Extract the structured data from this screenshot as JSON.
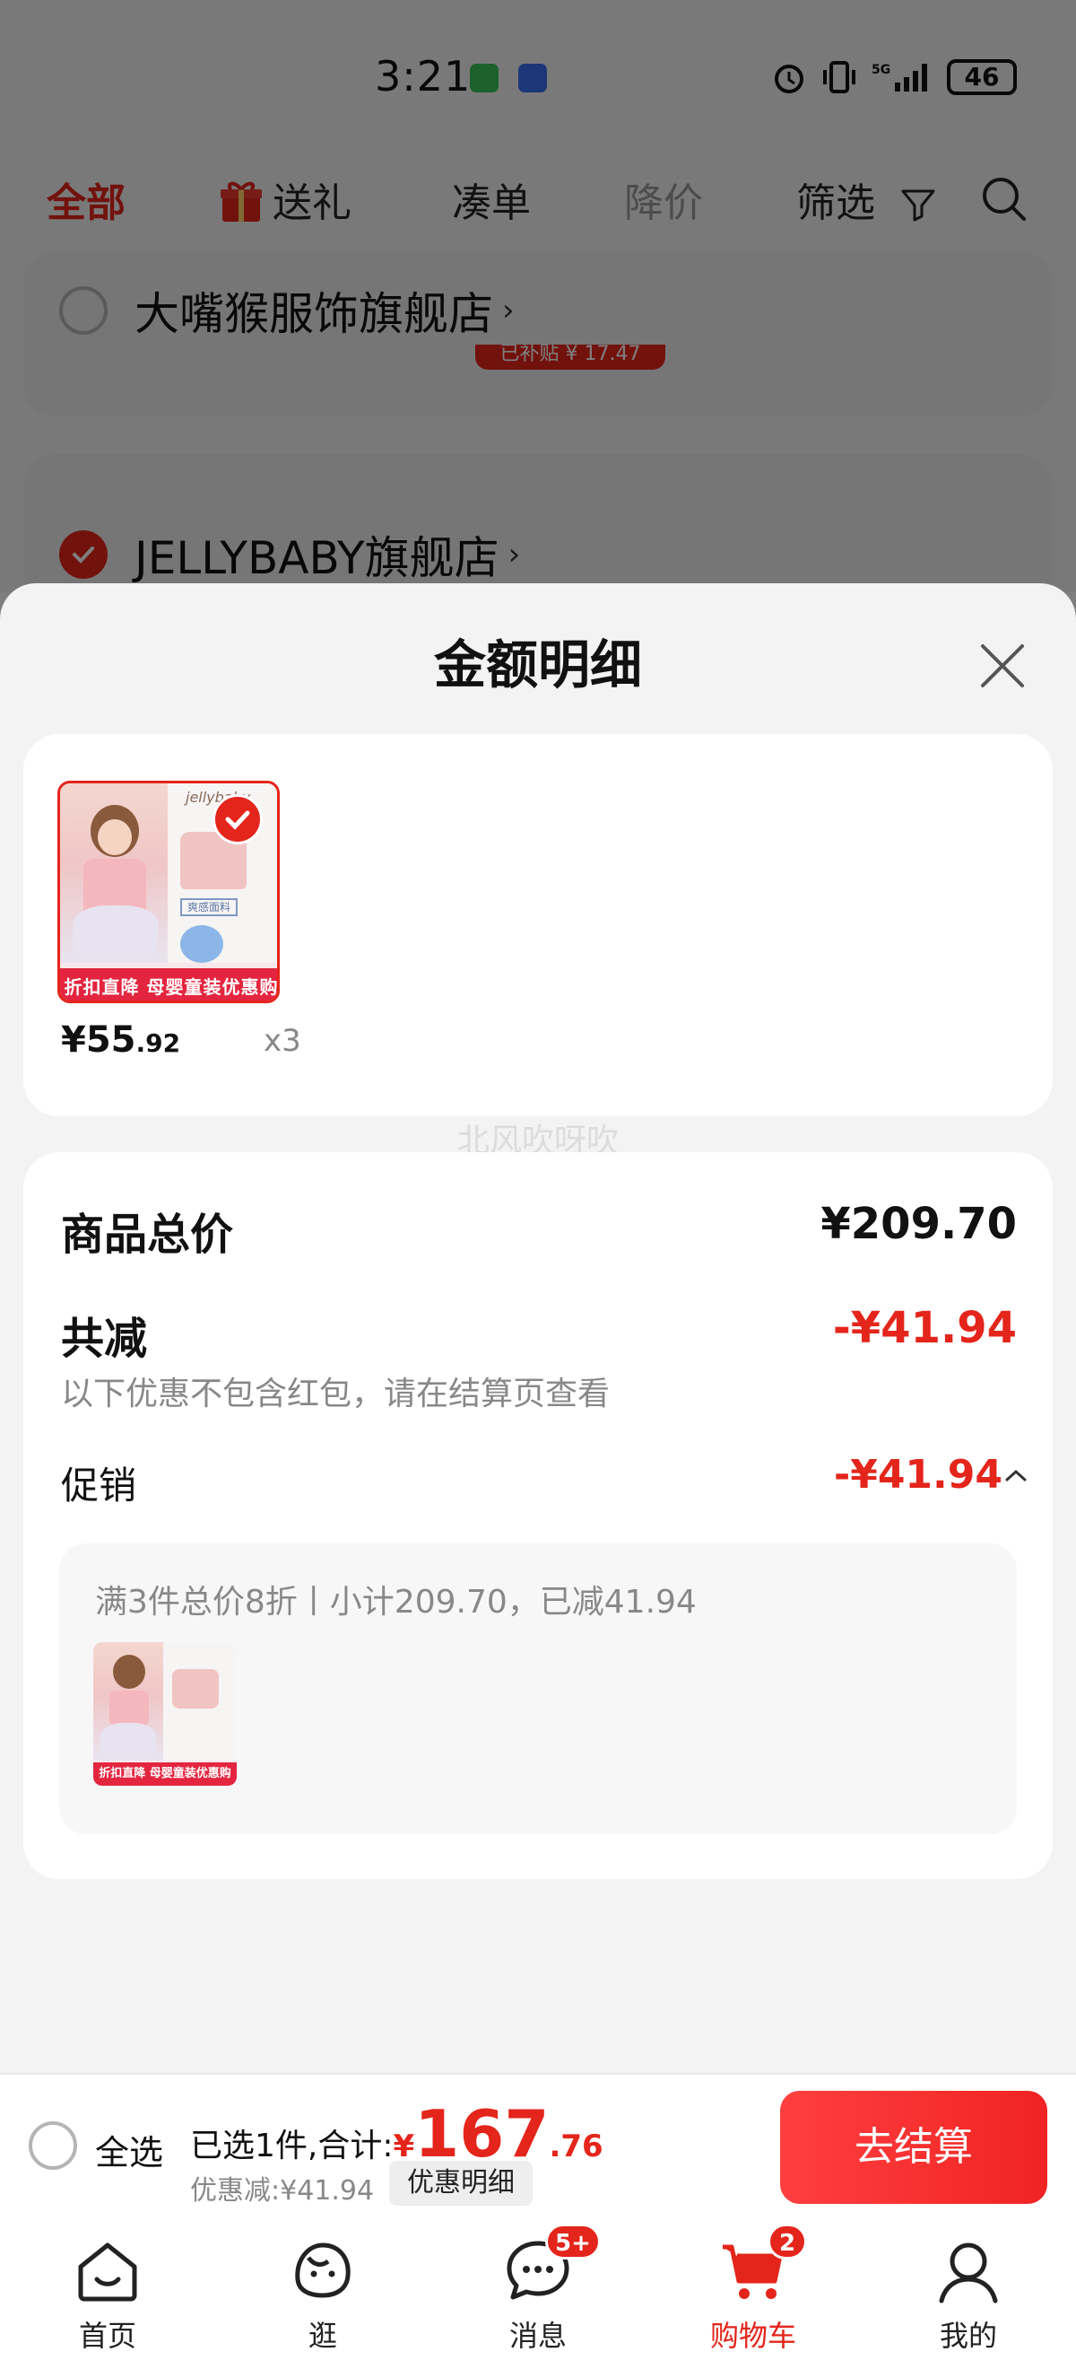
{
  "status_bar": {
    "time": "3:21",
    "battery": "46"
  },
  "top_tabs": {
    "all": "全部",
    "gift": "送礼",
    "combine": "凑单",
    "price_drop": "降价",
    "filter": "筛选"
  },
  "stores": [
    {
      "name": "大嘴猴服饰旗舰店",
      "subsidy": "已补贴 ¥ 17.47"
    },
    {
      "name": "JELLYBABY旗舰店"
    }
  ],
  "sheet": {
    "title": "金额明细",
    "item": {
      "brand": "jellybaby",
      "thumb_tag": "爽感面料",
      "thumb_banner": "折扣直降 母婴童装优惠购",
      "price_int": "¥55",
      "price_dec": ".92",
      "qty": "x3"
    },
    "watermark": "北风吹呀吹",
    "total_label": "商品总价",
    "total_value": "¥209.70",
    "reduce_label": "共减",
    "reduce_value": "-¥41.94",
    "note": "以下优惠不包含红包，请在结算页查看",
    "promo_label": "促销",
    "promo_value": "-¥41.94",
    "promo_desc": "满3件总价8折丨小计209.70，已减41.94"
  },
  "checkout": {
    "select_all": "全选",
    "selected_prefix": "已选1件,合计:",
    "currency": "¥",
    "total_int": "167",
    "total_dec": ".76",
    "discount": "优惠减:¥41.94",
    "detail_chip": "优惠明细",
    "button": "去结算"
  },
  "nav": {
    "home": "首页",
    "browse": "逛",
    "messages": "消息",
    "messages_badge": "5+",
    "cart": "购物车",
    "cart_badge": "2",
    "mine": "我的"
  },
  "colors": {
    "accent": "#e4251b",
    "checkout_button": "#f02323"
  }
}
